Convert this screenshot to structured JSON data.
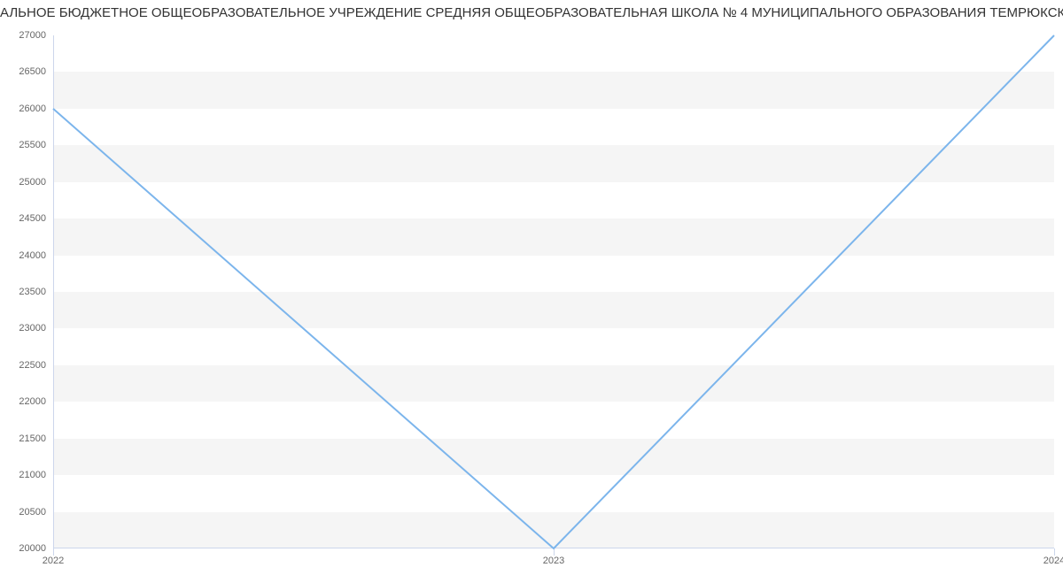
{
  "chart_data": {
    "type": "line",
    "title": "АЛЬНОЕ БЮДЖЕТНОЕ ОБЩЕОБРАЗОВАТЕЛЬНОЕ УЧРЕЖДЕНИЕ СРЕДНЯЯ ОБЩЕОБРАЗОВАТЕЛЬНАЯ ШКОЛА № 4 МУНИЦИПАЛЬНОГО ОБРАЗОВАНИЯ ТЕМРЮКСКИЙ РАЙОН",
    "categories": [
      "2022",
      "2023",
      "2024"
    ],
    "values": [
      26000,
      20000,
      27000
    ],
    "xlabel": "",
    "ylabel": "",
    "ylim": [
      20000,
      27000
    ],
    "y_ticks": [
      20000,
      20500,
      21000,
      21500,
      22000,
      22500,
      23000,
      23500,
      24000,
      24500,
      25000,
      25500,
      26000,
      26500,
      27000
    ],
    "series_color": "#7cb5ec",
    "grid_band_color": "#f5f5f5"
  }
}
